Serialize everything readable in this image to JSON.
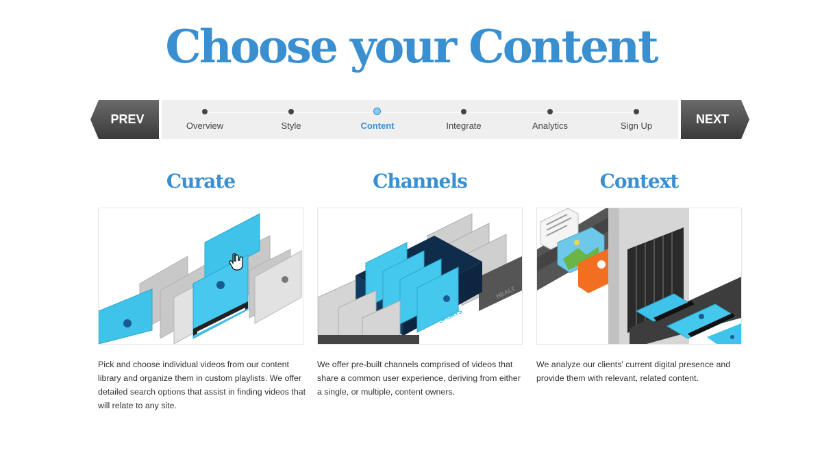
{
  "page": {
    "title": "Choose your Content"
  },
  "wizard": {
    "prev_label": "PREV",
    "next_label": "NEXT",
    "steps": [
      {
        "label": "Overview",
        "active": false
      },
      {
        "label": "Style",
        "active": false
      },
      {
        "label": "Content",
        "active": true
      },
      {
        "label": "Integrate",
        "active": false
      },
      {
        "label": "Analytics",
        "active": false
      },
      {
        "label": "Sign Up",
        "active": false
      }
    ]
  },
  "columns": [
    {
      "heading": "Curate",
      "description": "Pick and choose individual videos from our content library and organize them in custom playlists. We offer detailed search options that assist in finding videos that will relate to any site."
    },
    {
      "heading": "Channels",
      "description": "We offer pre-built channels comprised of videos that share a common user experience, deriving from either a single, or multiple, content owners.",
      "tray_label": "SPORTS",
      "tray_label_2": "HEALT"
    },
    {
      "heading": "Context",
      "description": "We analyze our clients' current digital presence and provide them with relevant, related content."
    }
  ],
  "colors": {
    "accent": "#3a8fd0",
    "video_cyan": "#3fc3ea",
    "button_dark": "#4a4a4a",
    "steps_bg": "#efefef"
  },
  "icons": {
    "cursor": "hand-pointer-icon",
    "play": "play-icon"
  }
}
